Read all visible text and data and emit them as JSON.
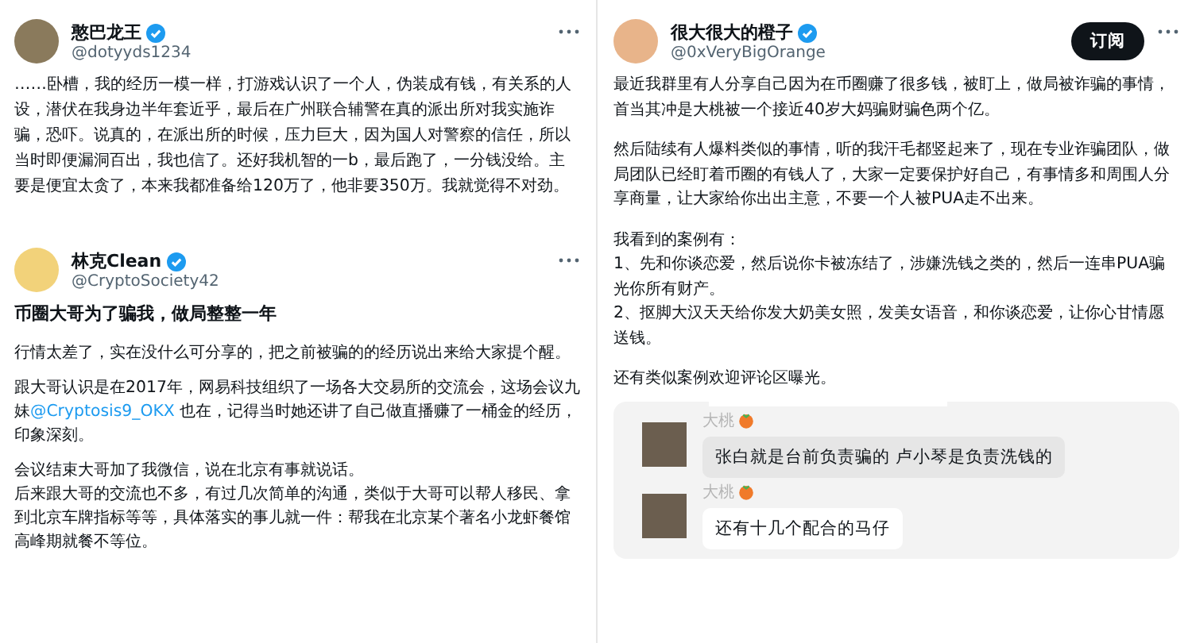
{
  "tweets": [
    {
      "author": "憨巴龙王",
      "handle": "@dotyyds1234",
      "verified": true,
      "paragraphs": [
        [
          {
            "kind": "text",
            "text": "……卧槽，我的经历一模一样，打游戏认识了一个人，伪装成有钱，有关系的人设，潜伏在我身边半年套近乎，最后在广州联合辅警在真的派出所对我实施诈骗，恐吓。说真的，在派出所的时候，压力巨大，因为国人对警察的信任，所以当时即便漏洞百出，我也信了。还好我机智的一b，最后跑了，一分钱没给。主要是便宜太贪了，本来我都准备给120万了，他非要350万。我就觉得不对劲。"
          }
        ]
      ]
    },
    {
      "author": "林克Clean",
      "handle": "@CryptoSociety42",
      "verified": true,
      "title": "币圈大哥为了骗我，做局整整一年",
      "paragraphs": [
        [
          {
            "kind": "text",
            "text": "行情太差了，实在没什么可分享的，把之前被骗的的经历说出来给大家提个醒。"
          }
        ],
        [
          {
            "kind": "text",
            "text": "跟大哥认识是在2017年，网易科技组织了一场各大交易所的交流会，这场会议九妹"
          },
          {
            "kind": "link",
            "text": "@Cryptosis9_OKX"
          },
          {
            "kind": "text",
            "text": " 也在，记得当时她还讲了自己做直播赚了一桶金的经历，印象深刻。"
          }
        ],
        [
          {
            "kind": "text",
            "text": "会议结束大哥加了我微信，说在北京有事就说话。"
          },
          {
            "kind": "break"
          },
          {
            "kind": "text",
            "text": "后来跟大哥的交流也不多，有过几次简单的沟通，类似于大哥可以帮人移民、拿到北京车牌指标等等，具体落实的事儿就一件：帮我在北京某个著名小龙虾餐馆高峰期就餐不等位。"
          }
        ]
      ]
    },
    {
      "author": "很大很大的橙子",
      "handle": "@0xVeryBigOrange",
      "verified": true,
      "subscribe": "订阅",
      "paragraphs": [
        [
          {
            "kind": "text",
            "text": "最近我群里有人分享自己因为在币圈赚了很多钱，被盯上，做局被诈骗的事情，首当其冲是大桃被一个接近40岁大妈骗财骗色两个亿。"
          }
        ],
        [
          {
            "kind": "text",
            "text": "然后陆续有人爆料类似的事情，听的我汗毛都竖起来了，现在专业诈骗团队，做局团队已经盯着币圈的有钱人了，大家一定要保护好自己，有事情多和周围人分享商量，让大家给你出出主意，不要一个人被PUA走不出来。"
          }
        ],
        [
          {
            "kind": "text",
            "text": "我看到的案例有："
          },
          {
            "kind": "break"
          },
          {
            "kind": "text",
            "text": "1、先和你谈恋爱，然后说你卡被冻结了，涉嫌洗钱之类的，然后一连串PUA骗光你所有财产。"
          },
          {
            "kind": "break"
          },
          {
            "kind": "text",
            "text": "2、抠脚大汉天天给你发大奶美女照，发美女语音，和你谈恋爱，让你心甘情愿送钱。"
          }
        ],
        [
          {
            "kind": "text",
            "text": "还有类似案例欢迎评论区曝光。"
          }
        ]
      ],
      "chat": [
        {
          "sender": "大桃",
          "text": "张白就是台前负责骗的 卢小琴是负责洗钱的",
          "selected": true
        },
        {
          "sender": "大桃",
          "text": "还有十几个配合的马仔",
          "selected": false
        }
      ]
    }
  ]
}
